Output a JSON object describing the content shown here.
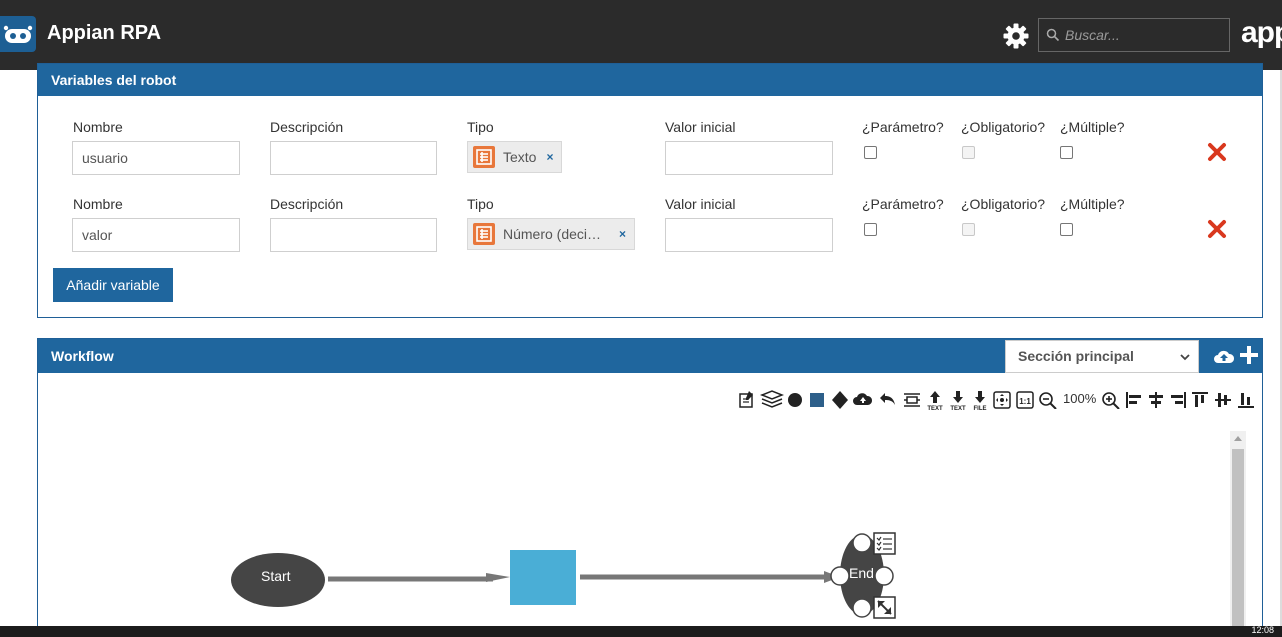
{
  "header": {
    "app_title": "Appian RPA",
    "search_placeholder": "Buscar...",
    "brand_text": "appian"
  },
  "variables_panel": {
    "title": "Variables del robot",
    "labels": {
      "name": "Nombre",
      "description": "Descripción",
      "type": "Tipo",
      "initial_value": "Valor inicial",
      "parameter": "¿Parámetro?",
      "required": "¿Obligatorio?",
      "multiple": "¿Múltiple?"
    },
    "rows": [
      {
        "name": "usuario",
        "description": "",
        "type": "Texto",
        "initial_value": "",
        "parameter": false,
        "required": false,
        "multiple": false
      },
      {
        "name": "valor",
        "description": "",
        "type": "Número (decimal)",
        "initial_value": "",
        "parameter": false,
        "required": false,
        "multiple": false
      }
    ],
    "add_button": "Añadir variable"
  },
  "workflow_panel": {
    "title": "Workflow",
    "section_selected": "Sección principal",
    "zoom": "100%",
    "toolbar_icons": [
      "notes-icon",
      "layers-icon",
      "circle-icon",
      "square-icon",
      "diamond-icon",
      "cloud-icon",
      "undo-icon",
      "align-text-icon",
      "upload-text-icon",
      "download-text-icon",
      "download-file-icon",
      "fit-screen-icon",
      "actual-size-icon",
      "zoom-out-icon",
      "zoom-in-icon",
      "align-left-icon",
      "align-center-icon",
      "align-right-icon",
      "align-top-icon",
      "align-middle-icon",
      "align-bottom-icon"
    ],
    "tb_labels": {
      "upload": "TEXT",
      "download": "TEXT",
      "file": "FILE",
      "one": "1:1"
    },
    "nodes": {
      "start": "Start",
      "end": "End"
    }
  },
  "taskbar": {
    "clock": "12:08"
  },
  "colors": {
    "header_bg": "#2b2b2b",
    "panel_header": "#1f669e",
    "start_node": "#454545",
    "task_node": "#4aaed6",
    "delete_red": "#d9381e",
    "tag_icon": "#e8773b"
  }
}
